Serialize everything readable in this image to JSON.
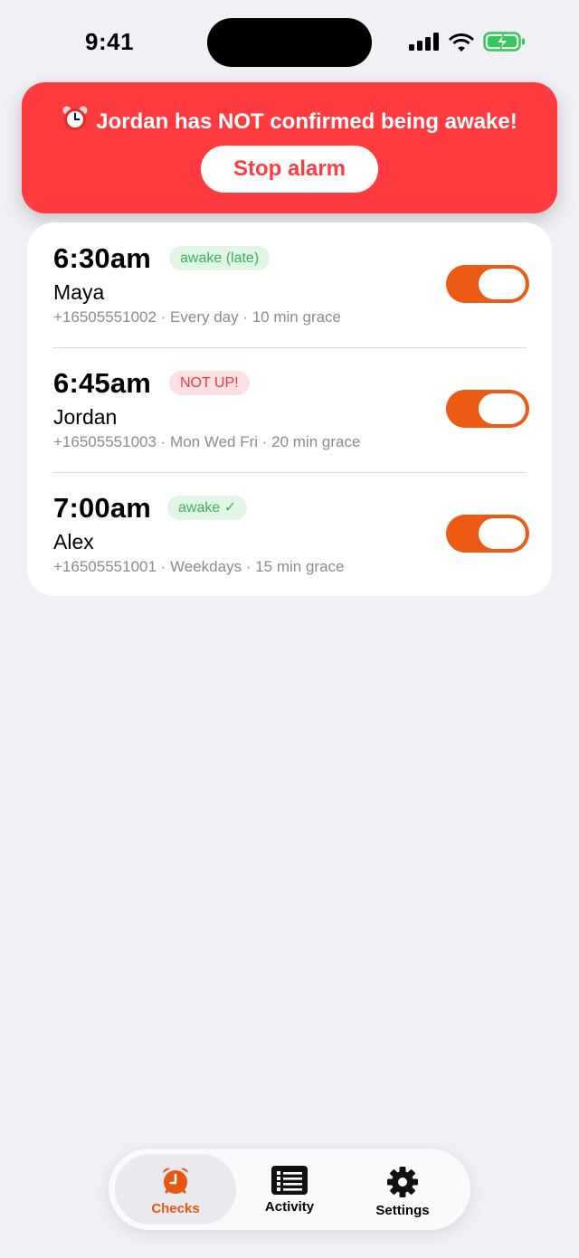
{
  "status_bar": {
    "time": "9:41",
    "icons": [
      "signal-icon",
      "wifi-icon",
      "battery-charging-icon"
    ]
  },
  "alert": {
    "icon": "alarm-clock-icon",
    "message": "Jordan has NOT confirmed being awake!",
    "button_label": "Stop alarm",
    "color": "#ff3b3f"
  },
  "checks": [
    {
      "time": "6:30am",
      "status": "awake (late)",
      "status_type": "awake",
      "name": "Maya",
      "detail": "+16505551002 · Every day · 10 min grace",
      "enabled": true
    },
    {
      "time": "6:45am",
      "status": "NOT UP!",
      "status_type": "not-up",
      "name": "Jordan",
      "detail": "+16505551003 · Mon Wed Fri · 20 min grace",
      "enabled": true
    },
    {
      "time": "7:00am",
      "status": "awake ✓",
      "status_type": "awake",
      "name": "Alex",
      "detail": "+16505551001 · Weekdays · 15 min grace",
      "enabled": true
    }
  ],
  "tabs": [
    {
      "label": "Checks",
      "icon": "alarm-clock-icon",
      "active": true
    },
    {
      "label": "Activity",
      "icon": "list-icon",
      "active": false
    },
    {
      "label": "Settings",
      "icon": "gear-icon",
      "active": false
    }
  ],
  "colors": {
    "accent": "#ec5a14",
    "awake_badge": "#36b455",
    "not_up_badge": "#e63b43"
  }
}
